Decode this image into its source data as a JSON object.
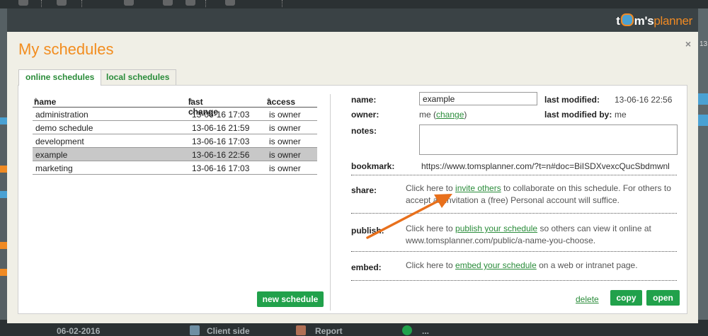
{
  "app": {
    "logo_prefix": "t",
    "logo_suffix": "m's",
    "logo_planner": "planner",
    "right_edge_number": "13"
  },
  "modal": {
    "title": "My schedules",
    "close": "×"
  },
  "tabs": [
    {
      "label": "online schedules",
      "active": true
    },
    {
      "label": "local schedules",
      "active": false
    }
  ],
  "list": {
    "headers": {
      "name": "name",
      "last_change": "last change",
      "access": "access"
    },
    "sort_glyph": "◆",
    "rows": [
      {
        "name": "administration",
        "last_change": "13-06-16 17:03",
        "access": "is owner",
        "selected": false
      },
      {
        "name": "demo schedule",
        "last_change": "13-06-16 21:59",
        "access": "is owner",
        "selected": false
      },
      {
        "name": "development",
        "last_change": "13-06-16 17:03",
        "access": "is owner",
        "selected": false
      },
      {
        "name": "example",
        "last_change": "13-06-16 22:56",
        "access": "is owner",
        "selected": true
      },
      {
        "name": "marketing",
        "last_change": "13-06-16 17:03",
        "access": "is owner",
        "selected": false
      }
    ],
    "new_button": "new schedule"
  },
  "details": {
    "name_label": "name:",
    "name_value": "example",
    "last_modified_label": "last modified:",
    "last_modified_value": "13-06-16 22:56",
    "owner_label": "owner:",
    "owner_value": "me (",
    "owner_change_link": "change",
    "owner_close_paren": ")",
    "last_modified_by_label": "last modified by:",
    "last_modified_by_value": "me",
    "notes_label": "notes:",
    "notes_value": "",
    "bookmark_label": "bookmark:",
    "bookmark_value": "https://www.tomsplanner.com/?t=n#doc=BiISDXvexcQucSbdmwnl",
    "share_label": "share:",
    "share_pre": "Click here to ",
    "share_link": "invite others",
    "share_post": " to collaborate on this schedule. For others to accept an invitation a (free) Personal account will suffice.",
    "publish_label": "publish:",
    "publish_pre": "Click here to ",
    "publish_link": "publish your schedule",
    "publish_post": " so others can view it online at www.tomsplanner.com/public/a-name-you-choose.",
    "embed_label": "embed:",
    "embed_pre": "Click here to ",
    "embed_link": "embed your schedule",
    "embed_post": " on a web or intranet page.",
    "delete_link": "delete",
    "copy_button": "copy",
    "open_button": "open"
  },
  "bottombar": {
    "date": "06-02-2016",
    "client_side": "Client side",
    "report": "Report",
    "more": "..."
  },
  "colors": {
    "accent_orange": "#f28d1f",
    "link_green": "#2a8c3a",
    "button_green": "#21a14b",
    "arrow_orange": "#e8701c"
  }
}
